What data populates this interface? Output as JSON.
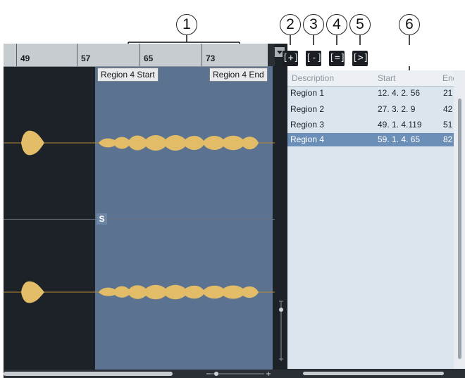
{
  "callouts": [
    "1",
    "2",
    "3",
    "4",
    "5",
    "6"
  ],
  "ruler": {
    "bars": [
      "49",
      "57",
      "65",
      "73"
    ]
  },
  "region_markers": {
    "start_label": "Region 4 Start",
    "end_label": "Region 4 End"
  },
  "editor": {
    "sync_marker": "S"
  },
  "toolbar": {
    "add_region_icon": "[+]",
    "remove_region_icon": "[-]",
    "select_region_icon": "[=]",
    "play_region_icon": "[>]"
  },
  "region_list": {
    "columns": [
      "Description",
      "Start",
      "End"
    ],
    "rows": [
      {
        "description": "Region 1",
        "start": "12. 4. 2. 56",
        "end": "21"
      },
      {
        "description": "Region 2",
        "start": "27. 3. 2.  9",
        "end": "42"
      },
      {
        "description": "Region 3",
        "start": "49. 1. 4.119",
        "end": "51"
      },
      {
        "description": "Region 4",
        "start": "59. 1. 4. 65",
        "end": "82"
      }
    ],
    "selected_index": 3
  },
  "colors": {
    "waveform": "#e2bc67",
    "region_highlight": "#5b7390",
    "selected_row": "#6b8fb7"
  }
}
